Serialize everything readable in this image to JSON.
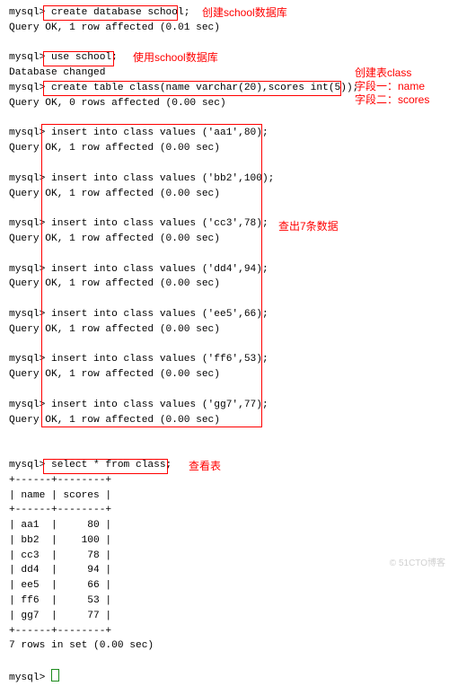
{
  "terminal": {
    "lines": [
      "mysql> create database school;",
      "Query OK, 1 row affected (0.01 sec)",
      "",
      "mysql> use school;",
      "Database changed",
      "mysql> create table class(name varchar(20),scores int(5));",
      "Query OK, 0 rows affected (0.00 sec)",
      "",
      "mysql> insert into class values ('aa1',80);",
      "Query OK, 1 row affected (0.00 sec)",
      "",
      "mysql> insert into class values ('bb2',100);",
      "Query OK, 1 row affected (0.00 sec)",
      "",
      "mysql> insert into class values ('cc3',78);",
      "Query OK, 1 row affected (0.00 sec)",
      "",
      "mysql> insert into class values ('dd4',94);",
      "Query OK, 1 row affected (0.00 sec)",
      "",
      "mysql> insert into class values ('ee5',66);",
      "Query OK, 1 row affected (0.00 sec)",
      "",
      "mysql> insert into class values ('ff6',53);",
      "Query OK, 1 row affected (0.00 sec)",
      "",
      "mysql> insert into class values ('gg7',77);",
      "Query OK, 1 row affected (0.00 sec)",
      "",
      "",
      "mysql> select * from class;",
      "+------+--------+",
      "| name | scores |",
      "+------+--------+",
      "| aa1  |     80 |",
      "| bb2  |    100 |",
      "| cc3  |     78 |",
      "| dd4  |     94 |",
      "| ee5  |     66 |",
      "| ff6  |     53 |",
      "| gg7  |     77 |",
      "+------+--------+",
      "7 rows in set (0.00 sec)",
      "",
      "mysql> "
    ]
  },
  "annotations": {
    "createDb": "创建school数据库",
    "useDb": "使用school数据库",
    "createTable1": "创建表class",
    "createTable2": "字段一：name",
    "createTable3": "字段二：scores",
    "inserts": "查出7条数据",
    "select": "查看表"
  },
  "chart_data": {
    "type": "table",
    "columns": [
      "name",
      "scores"
    ],
    "rows": [
      {
        "name": "aa1",
        "scores": 80
      },
      {
        "name": "bb2",
        "scores": 100
      },
      {
        "name": "cc3",
        "scores": 78
      },
      {
        "name": "dd4",
        "scores": 94
      },
      {
        "name": "ee5",
        "scores": 66
      },
      {
        "name": "ff6",
        "scores": 53
      },
      {
        "name": "gg7",
        "scores": 77
      }
    ],
    "footer": "7 rows in set (0.00 sec)"
  },
  "watermark": "© 51CTO博客"
}
